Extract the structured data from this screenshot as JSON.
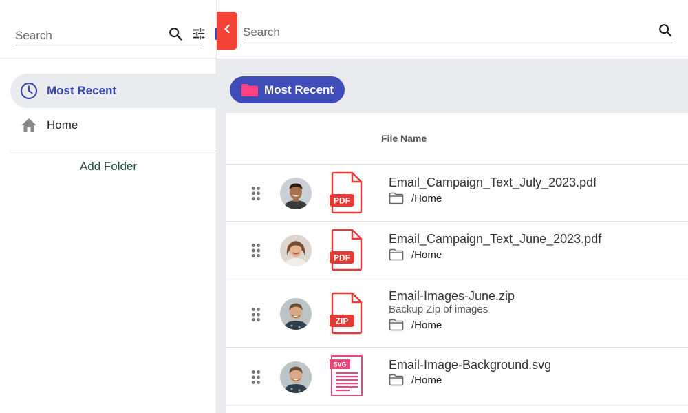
{
  "sidebar": {
    "search_placeholder": "Search",
    "nav": [
      {
        "label": "Most Recent",
        "icon": "clock-icon",
        "active": true
      },
      {
        "label": "Home",
        "icon": "home-icon",
        "active": false
      }
    ],
    "add_folder_label": "Add Folder"
  },
  "main": {
    "search_placeholder": "Search",
    "chip_label": "Most Recent",
    "column_header": "File Name",
    "files": [
      {
        "name": "Email_Campaign_Text_July_2023.pdf",
        "description": "",
        "location": "/Home",
        "type": "PDF"
      },
      {
        "name": "Email_Campaign_Text_June_2023.pdf",
        "description": "",
        "location": "/Home",
        "type": "PDF"
      },
      {
        "name": "Email-Images-June.zip",
        "description": "Backup Zip of images",
        "location": "/Home",
        "type": "ZIP"
      },
      {
        "name": "Email-Image-Background.svg",
        "description": "",
        "location": "/Home",
        "type": "SVG"
      }
    ]
  },
  "colors": {
    "accent": "#3f4cb8",
    "active_text": "#3949ab",
    "file_red": "#e53935",
    "collapse_red": "#f44336",
    "chip_folder": "#ff4081"
  }
}
